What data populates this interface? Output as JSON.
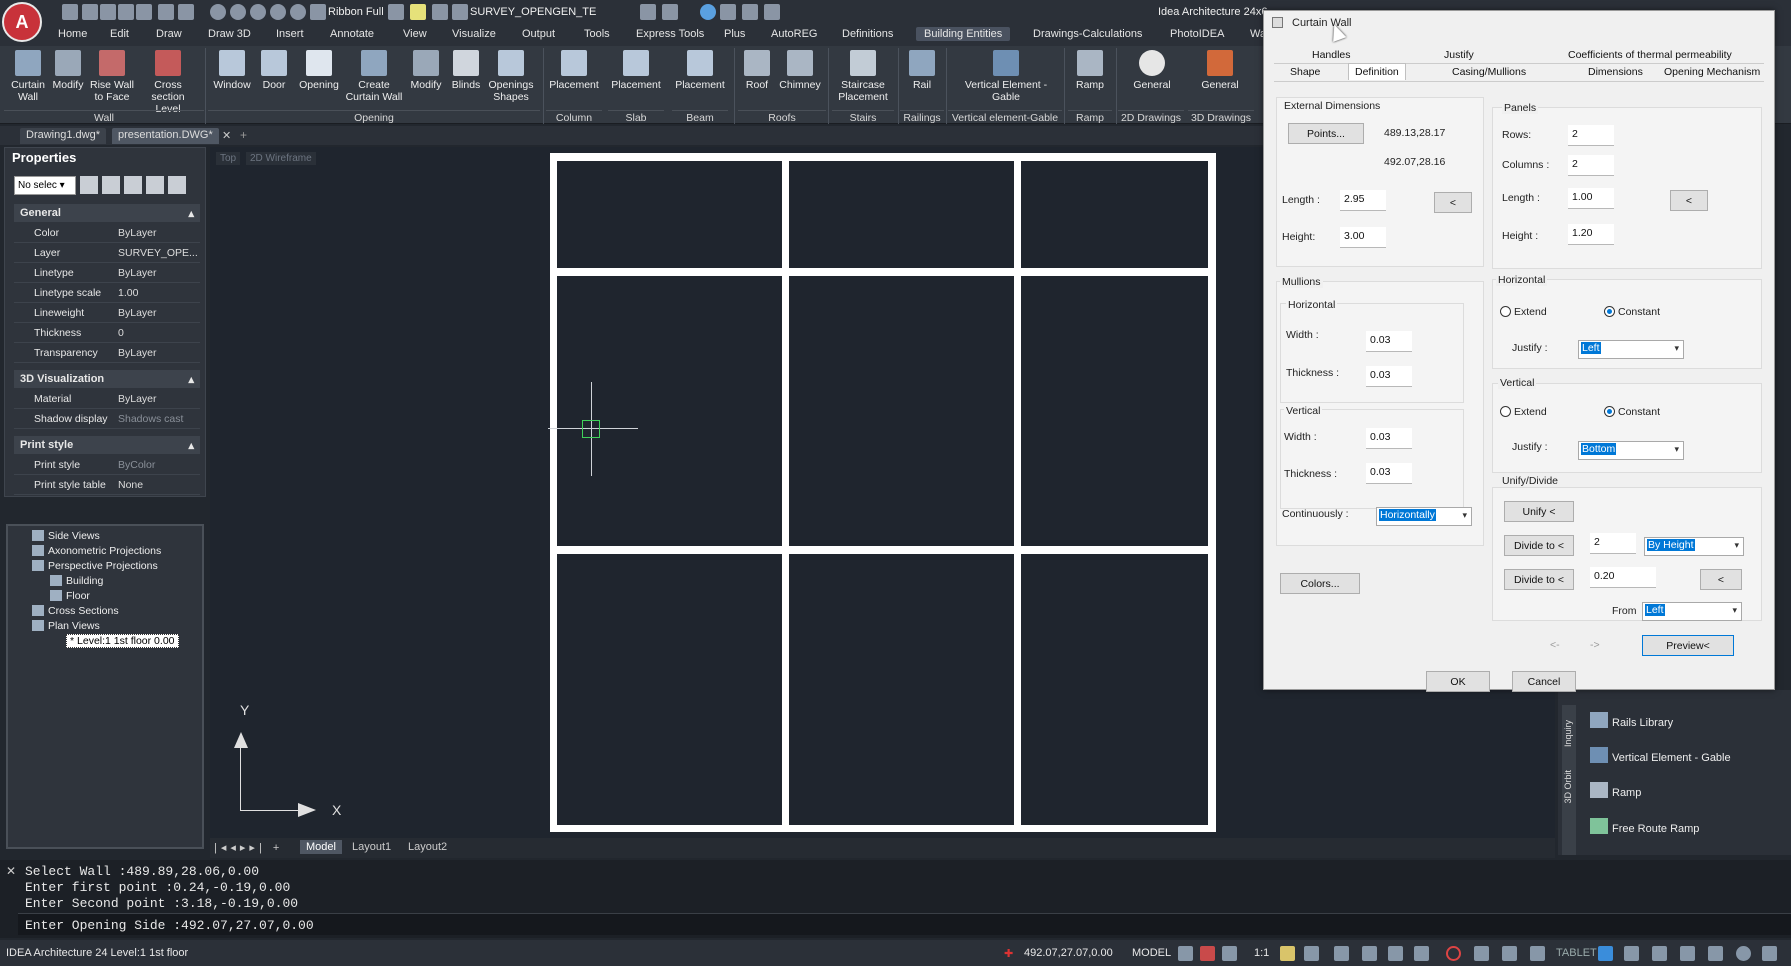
{
  "app": {
    "logo": "A",
    "title": "Idea Architecture 24x6"
  },
  "quick_access": {
    "ribbon_label": "Ribbon Full",
    "layer_value": "SURVEY_OPENGEN_TE"
  },
  "menu_tabs": [
    "Home",
    "Edit",
    "Draw",
    "Draw 3D",
    "Insert",
    "Annotate",
    "View",
    "Visualize",
    "Output",
    "Tools",
    "Express Tools",
    "Plus",
    "AutoREG",
    "Definitions",
    "Building Entities",
    "Drawings-Calculations",
    "PhotoIDEA",
    "Wa"
  ],
  "ribbon": {
    "buttons": [
      "Curtain Wall",
      "Modify",
      "Rise Wall to Face",
      "Cross section Level",
      "Window",
      "Door",
      "Opening",
      "Create Curtain Wall",
      "Modify",
      "Blinds",
      "Openings Shapes",
      "Placement",
      "Placement",
      "Placement",
      "Roof",
      "Chimney",
      "Staircase Placement",
      "Rail",
      "Vertical Element - Gable",
      "Ramp",
      "General",
      "General"
    ],
    "groups": [
      "Wall",
      "Opening",
      "Column",
      "Slab",
      "Beam",
      "Roofs",
      "Stairs",
      "Railings",
      "Vertical element-Gable",
      "Ramp",
      "2D Drawings",
      "3D Drawings"
    ]
  },
  "file_tabs": [
    "Drawing1.dwg*",
    "presentation.DWG*"
  ],
  "properties": {
    "title": "Properties",
    "selection": "No selec",
    "general": {
      "title": "General",
      "rows": [
        [
          "Color",
          "ByLayer"
        ],
        [
          "Layer",
          "SURVEY_OPE..."
        ],
        [
          "Linetype",
          "ByLayer"
        ],
        [
          "Linetype scale",
          "1.00"
        ],
        [
          "Lineweight",
          "ByLayer"
        ],
        [
          "Thickness",
          "0"
        ],
        [
          "Transparency",
          "ByLayer"
        ]
      ]
    },
    "viz": {
      "title": "3D Visualization",
      "rows": [
        [
          "Material",
          "ByLayer"
        ],
        [
          "Shadow display",
          "Shadows cast"
        ]
      ]
    },
    "print": {
      "title": "Print style",
      "rows": [
        [
          "Print style",
          "ByColor"
        ],
        [
          "Print style table",
          "None"
        ]
      ]
    }
  },
  "tree": [
    "Side Views",
    "Axonometric Projections",
    "Perspective Projections",
    "Building",
    "Floor",
    "Cross Sections",
    "Plan Views",
    "Level:1 1st floor 0.00"
  ],
  "viewport": {
    "view": "Top",
    "style": "2D Wireframe",
    "axis_y": "Y",
    "axis_x": "X"
  },
  "dialog": {
    "title": "Curtain Wall",
    "tabs_row1": [
      "Handles",
      "Justify",
      "Coefficients of thermal permeability"
    ],
    "tabs_row2": [
      "Shape",
      "Definition",
      "Casing/Mullions",
      "Dimensions",
      "Opening Mechanism"
    ],
    "ext": {
      "title": "External Dimensions",
      "points_btn": "Points...",
      "p1": "489.13,28.17",
      "p2": "492.07,28.16",
      "length_lbl": "Length :",
      "length": "2.95",
      "height_lbl": "Height:",
      "height": "3.00",
      "pick": "<"
    },
    "panels": {
      "title": "Panels",
      "rows_lbl": "Rows:",
      "rows": "2",
      "cols_lbl": "Columns :",
      "cols": "2",
      "length_lbl": "Length :",
      "length": "1.00",
      "height_lbl": "Height :",
      "height": "1.20",
      "pick": "<"
    },
    "mullions": {
      "title": "Mullions",
      "h_title": "Horizontal",
      "v_title": "Vertical",
      "width_lbl": "Width :",
      "thick_lbl": "Thickness :",
      "h_width": "0.03",
      "h_thick": "0.03",
      "v_width": "0.03",
      "v_thick": "0.03",
      "cont_lbl": "Continuously :",
      "cont": "Horizontally"
    },
    "horizontal": {
      "title": "Horizontal",
      "extend": "Extend",
      "constant": "Constant",
      "justify_lbl": "Justify :",
      "justify": "Left"
    },
    "vertical": {
      "title": "Vertical",
      "extend": "Extend",
      "constant": "Constant",
      "justify_lbl": "Justify :",
      "justify": "Bottom"
    },
    "unify": {
      "title": "Unify/Divide",
      "unify_btn": "Unify <",
      "divide_btn": "Divide to <",
      "divide1": "2",
      "divide1_sel": "By Height",
      "divide_btn2": "Divide to <",
      "divide2": "0.20",
      "pick": "<",
      "from_lbl": "From",
      "from": "Left"
    },
    "colors_btn": "Colors...",
    "prev": "<-",
    "next": "->",
    "preview": "Preview<",
    "ok": "OK",
    "cancel": "Cancel"
  },
  "palette": {
    "side_tabs": [
      "Inquiry",
      "3D Orbit"
    ],
    "items": [
      "Rails Library",
      "Vertical Element - Gable",
      "Ramp",
      "Free Route Ramp"
    ]
  },
  "layout_tabs": [
    "Model",
    "Layout1",
    "Layout2"
  ],
  "command_lines": [
    "Select Wall :489.89,28.06,0.00",
    "Enter first point :0.24,-0.19,0.00",
    "Enter Second point :3.18,-0.19,0.00",
    "Enter Opening Side :492.07,27.07,0.00"
  ],
  "status": {
    "left": "IDEA Architecture 24 Level:1 1st floor",
    "coords": "492.07,27.07,0.00",
    "model": "MODEL",
    "scale": "1:1",
    "tablet": "TABLET"
  }
}
